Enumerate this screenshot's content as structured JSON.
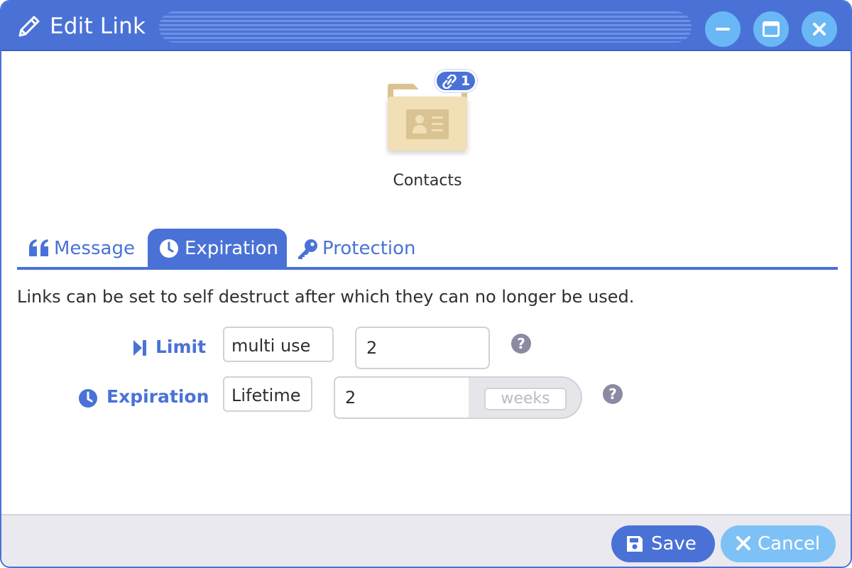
{
  "window": {
    "title": "Edit Link",
    "title_icon": "pencil-icon",
    "controls": [
      "minimize-icon",
      "maximize-icon",
      "close-icon"
    ]
  },
  "item": {
    "name": "Contacts",
    "icon": "contacts-folder-icon",
    "link_badge_count": "1",
    "badge_icon": "link-icon"
  },
  "tabs": [
    {
      "label": "Message",
      "icon": "quote-icon",
      "active": false
    },
    {
      "label": "Expiration",
      "icon": "clock-icon",
      "active": true
    },
    {
      "label": "Protection",
      "icon": "key-icon",
      "active": false
    }
  ],
  "description": "Links can be set to self destruct after which they can no longer be used.",
  "form": {
    "limit": {
      "label": "Limit",
      "icon": "step-forward-icon",
      "mode": "multi use",
      "value": "2",
      "help": "?"
    },
    "expiration": {
      "label": "Expiration",
      "icon": "clock-icon",
      "mode": "Lifetime",
      "value": "2",
      "unit": "weeks",
      "help": "?"
    }
  },
  "footer": {
    "save_label": "Save",
    "cancel_label": "Cancel"
  },
  "colors": {
    "accent": "#4a72d6",
    "secondary": "#7ec1f7",
    "folder": "#f1dfb6",
    "footer_bg": "#e9e9ef"
  }
}
